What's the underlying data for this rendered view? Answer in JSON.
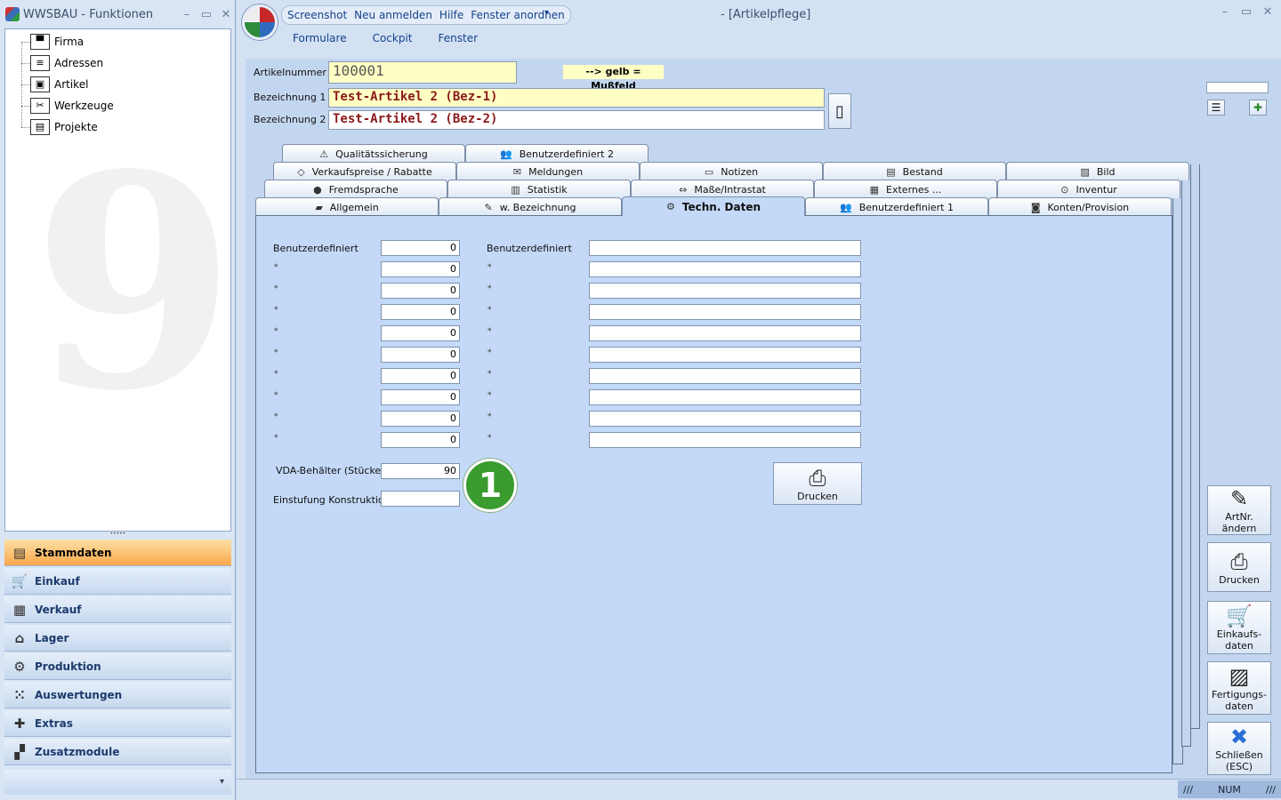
{
  "left_window": {
    "title": "WWSBAU - Funktionen",
    "controls": {
      "min": "–",
      "max": "▭",
      "close": "✕"
    },
    "tree": [
      {
        "label": "Firma",
        "icon": "factory-icon",
        "glyph": "▀"
      },
      {
        "label": "Adressen",
        "icon": "address-card-icon",
        "glyph": "≡"
      },
      {
        "label": "Artikel",
        "icon": "box-icon",
        "glyph": "▣"
      },
      {
        "label": "Werkzeuge",
        "icon": "tools-icon",
        "glyph": "✂"
      },
      {
        "label": "Projekte",
        "icon": "project-icon",
        "glyph": "▤"
      }
    ],
    "watermark": "9",
    "splitter": "•••••",
    "nav": [
      {
        "label": "Stammdaten",
        "icon": "stammdaten-icon",
        "glyph": "▤",
        "active": true
      },
      {
        "label": "Einkauf",
        "icon": "cart-icon",
        "glyph": "🛒"
      },
      {
        "label": "Verkauf",
        "icon": "register-icon",
        "glyph": "▦"
      },
      {
        "label": "Lager",
        "icon": "warehouse-icon",
        "glyph": "⌂"
      },
      {
        "label": "Produktion",
        "icon": "production-icon",
        "glyph": "⚙"
      },
      {
        "label": "Auswertungen",
        "icon": "analysis-icon",
        "glyph": "⁙"
      },
      {
        "label": "Extras",
        "icon": "extras-icon",
        "glyph": "✚"
      },
      {
        "label": "Zusatzmodule",
        "icon": "modules-icon",
        "glyph": "▞"
      }
    ],
    "nav_footer": "▾"
  },
  "main_window": {
    "title": "- [Artikelpflege]",
    "quick_access": [
      "Screenshot",
      "Neu anmelden",
      "Hilfe",
      "Fenster anordnen"
    ],
    "quick_access_dropdown": "▾",
    "controls": {
      "min": "–",
      "max": "▭",
      "close": "✕"
    },
    "menu": [
      "Formulare",
      "Cockpit",
      "Fenster"
    ]
  },
  "form": {
    "artikelnummer_label": "Artikelnummer :",
    "artikelnummer_value": "100001",
    "hint": "--> gelb = Mußfeld",
    "bez1_label": "Bezeichnung 1 :",
    "bez1_value": "Test-Artikel 2  (Bez-1)",
    "bez2_label": "Bezeichnung 2 :",
    "bez2_value": "Test-Artikel 2  (Bez-2)",
    "doc_button_icon": "document-icon"
  },
  "tabs": {
    "row4": [
      {
        "label": "Qualitätssicherung",
        "glyph": "⚠"
      },
      {
        "label": "Benutzerdefiniert 2",
        "glyph": "👥"
      }
    ],
    "row3": [
      {
        "label": "Verkaufspreise / Rabatte",
        "glyph": "◇"
      },
      {
        "label": "Meldungen",
        "glyph": "✉"
      },
      {
        "label": "Notizen",
        "glyph": "▭"
      },
      {
        "label": "Bestand",
        "glyph": "▤"
      },
      {
        "label": "Bild",
        "glyph": "▨"
      }
    ],
    "row2": [
      {
        "label": "Fremdsprache",
        "glyph": "●"
      },
      {
        "label": "Statistik",
        "glyph": "▥"
      },
      {
        "label": "Maße/Intrastat",
        "glyph": "⇔"
      },
      {
        "label": "Externes ...",
        "glyph": "▦"
      },
      {
        "label": "Inventur",
        "glyph": "⊙"
      }
    ],
    "row1": [
      {
        "label": "Allgemein",
        "glyph": "▰"
      },
      {
        "label": "w. Bezeichnung",
        "glyph": "✎"
      },
      {
        "label": "Techn. Daten",
        "glyph": "⚙",
        "active": true
      },
      {
        "label": "Benutzerdefiniert 1",
        "glyph": "👥"
      },
      {
        "label": "Konten/Provision",
        "glyph": "◙"
      }
    ]
  },
  "techn": {
    "num_label_first": "Benutzerdefiniert",
    "txt_label_first": "Benutzerdefiniert",
    "star": "*",
    "num_values": [
      "0",
      "0",
      "0",
      "0",
      "0",
      "0",
      "0",
      "0",
      "0",
      "0"
    ],
    "vda_label": "VDA-Behälter (Stücke):",
    "vda_value": "90",
    "einstufung_label": "Einstufung Konstruktion:",
    "einstufung_value": "",
    "drucken": "Drucken",
    "badge": "1"
  },
  "side_buttons": [
    {
      "label": "ArtNr. ändern",
      "glyph": "✎"
    },
    {
      "label": "Drucken",
      "glyph": "⎙"
    },
    {
      "label": "Einkaufs-daten",
      "glyph": "🛒"
    },
    {
      "label": "Fertigungs-daten",
      "glyph": "▨"
    },
    {
      "label": "Schließen (ESC)",
      "glyph": "✖"
    }
  ],
  "status": {
    "num": "NUM",
    "left_mark": "///",
    "right_mark": "///"
  }
}
